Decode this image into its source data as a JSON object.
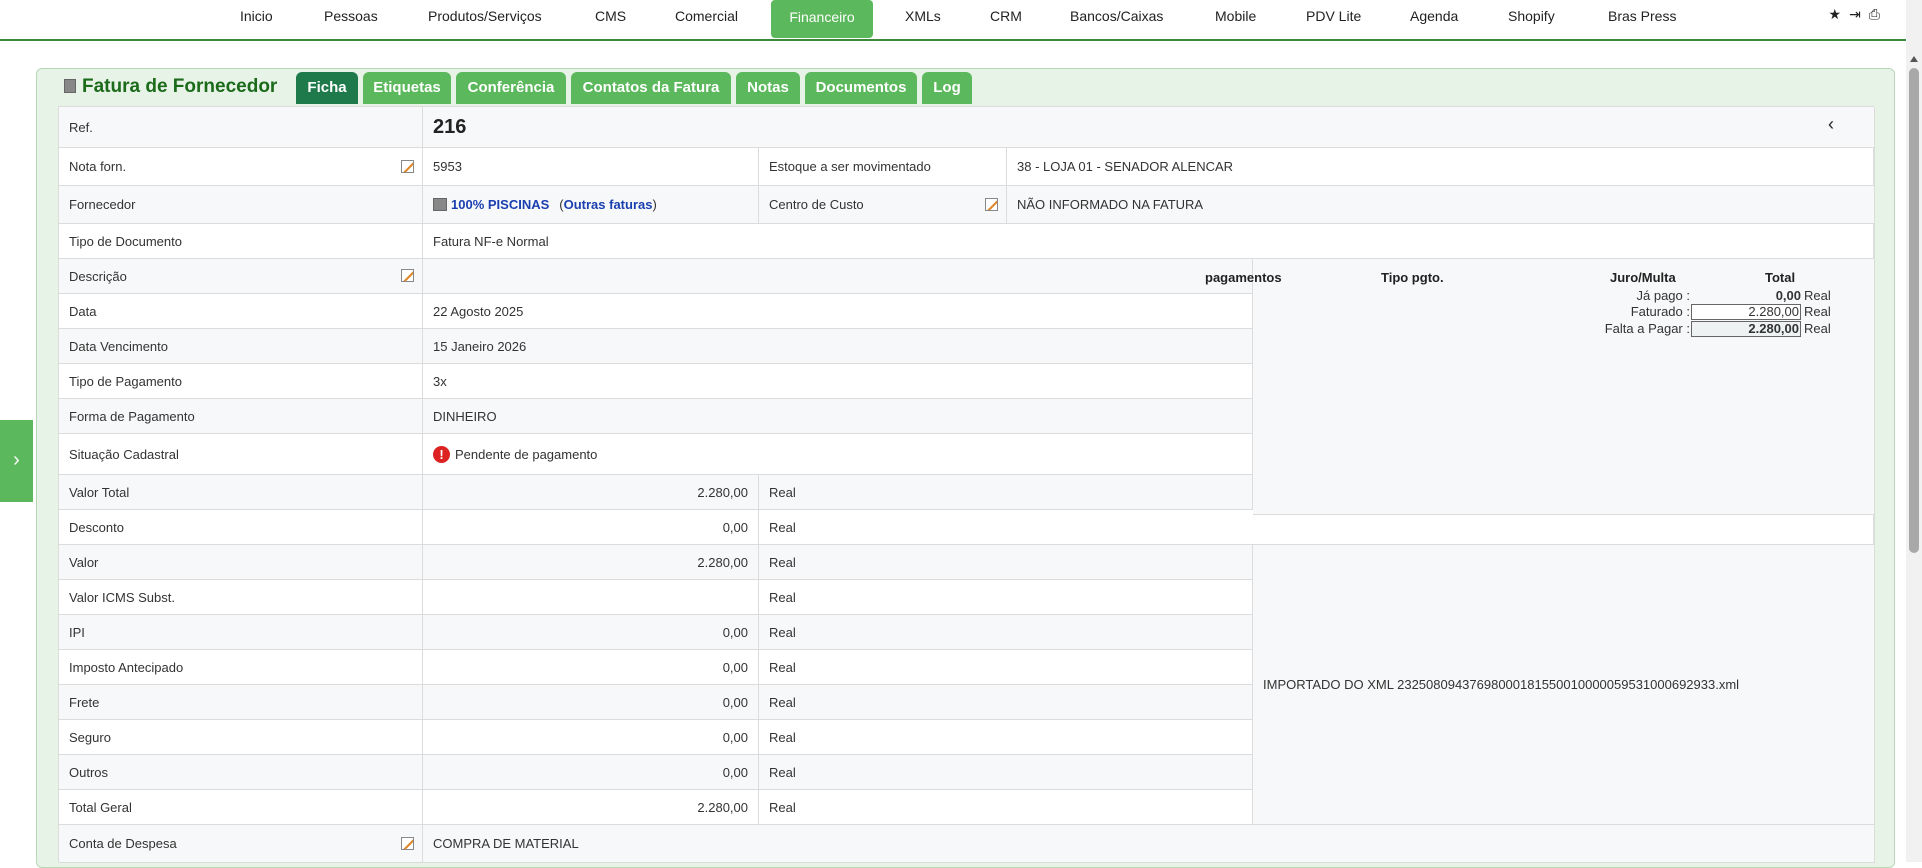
{
  "nav": {
    "items": [
      "Inicio",
      "Pessoas",
      "Produtos/Serviços",
      "CMS",
      "Comercial",
      "Financeiro",
      "XMLs",
      "CRM",
      "Bancos/Caixas",
      "Mobile",
      "PDV Lite",
      "Agenda",
      "Shopify",
      "Bras Press"
    ],
    "active": "Financeiro"
  },
  "header": {
    "title": "Fatura de Fornecedor",
    "tabs": [
      "Ficha",
      "Etiquetas",
      "Conferência",
      "Contatos da Fatura",
      "Notas",
      "Documentos",
      "Log"
    ],
    "active_tab": "Ficha"
  },
  "invoice": {
    "ref_label": "Ref.",
    "ref_value": "216",
    "nota_label": "Nota forn.",
    "nota_value": "5953",
    "estoque_label": "Estoque a ser movimentado",
    "estoque_value": "38 - LOJA 01 - SENADOR ALENCAR",
    "fornecedor_label": "Fornecedor",
    "fornecedor_value": "100% PISCINAS",
    "outras_faturas": "Outras faturas",
    "centro_label": "Centro de Custo",
    "centro_value": "NÃO INFORMADO NA FATURA",
    "tipo_doc_label": "Tipo de Documento",
    "tipo_doc_value": "Fatura NF-e Normal",
    "descricao_label": "Descrição",
    "descricao_value": "",
    "data_label": "Data",
    "data_value": "22 Agosto 2025",
    "venc_label": "Data Vencimento",
    "venc_value": "15 Janeiro 2026",
    "tipo_pag_label": "Tipo de Pagamento",
    "tipo_pag_value": "3x",
    "forma_label": "Forma de Pagamento",
    "forma_value": "DINHEIRO",
    "situacao_label": "Situação Cadastral",
    "situacao_value": "Pendente de pagamento",
    "conta_label": "Conta de Despesa",
    "conta_value": "COMPRA DE MATERIAL",
    "currency": "Real",
    "xml_note": "IMPORTADO DO XML 23250809437698000181550010000059531000692933.xml"
  },
  "amounts": [
    {
      "label": "Valor Total",
      "value": "2.280,00"
    },
    {
      "label": "Desconto",
      "value": "0,00"
    },
    {
      "label": "Valor",
      "value": "2.280,00"
    },
    {
      "label": "Valor ICMS Subst.",
      "value": ""
    },
    {
      "label": "IPI",
      "value": "0,00"
    },
    {
      "label": "Imposto Antecipado",
      "value": "0,00"
    },
    {
      "label": "Frete",
      "value": "0,00"
    },
    {
      "label": "Seguro",
      "value": "0,00"
    },
    {
      "label": "Outros",
      "value": "0,00"
    },
    {
      "label": "Total Geral",
      "value": "2.280,00"
    }
  ],
  "payments": {
    "headers": [
      "pagamentos",
      "Tipo pgto.",
      "Juro/Multa",
      "Total"
    ],
    "ja_pago_label": "Já pago :",
    "ja_pago_value": "0,00",
    "faturado_label": "Faturado :",
    "faturado_value": "2.280,00",
    "falta_label": "Falta a Pagar :",
    "falta_value": "2.280,00",
    "unit": "Real"
  }
}
